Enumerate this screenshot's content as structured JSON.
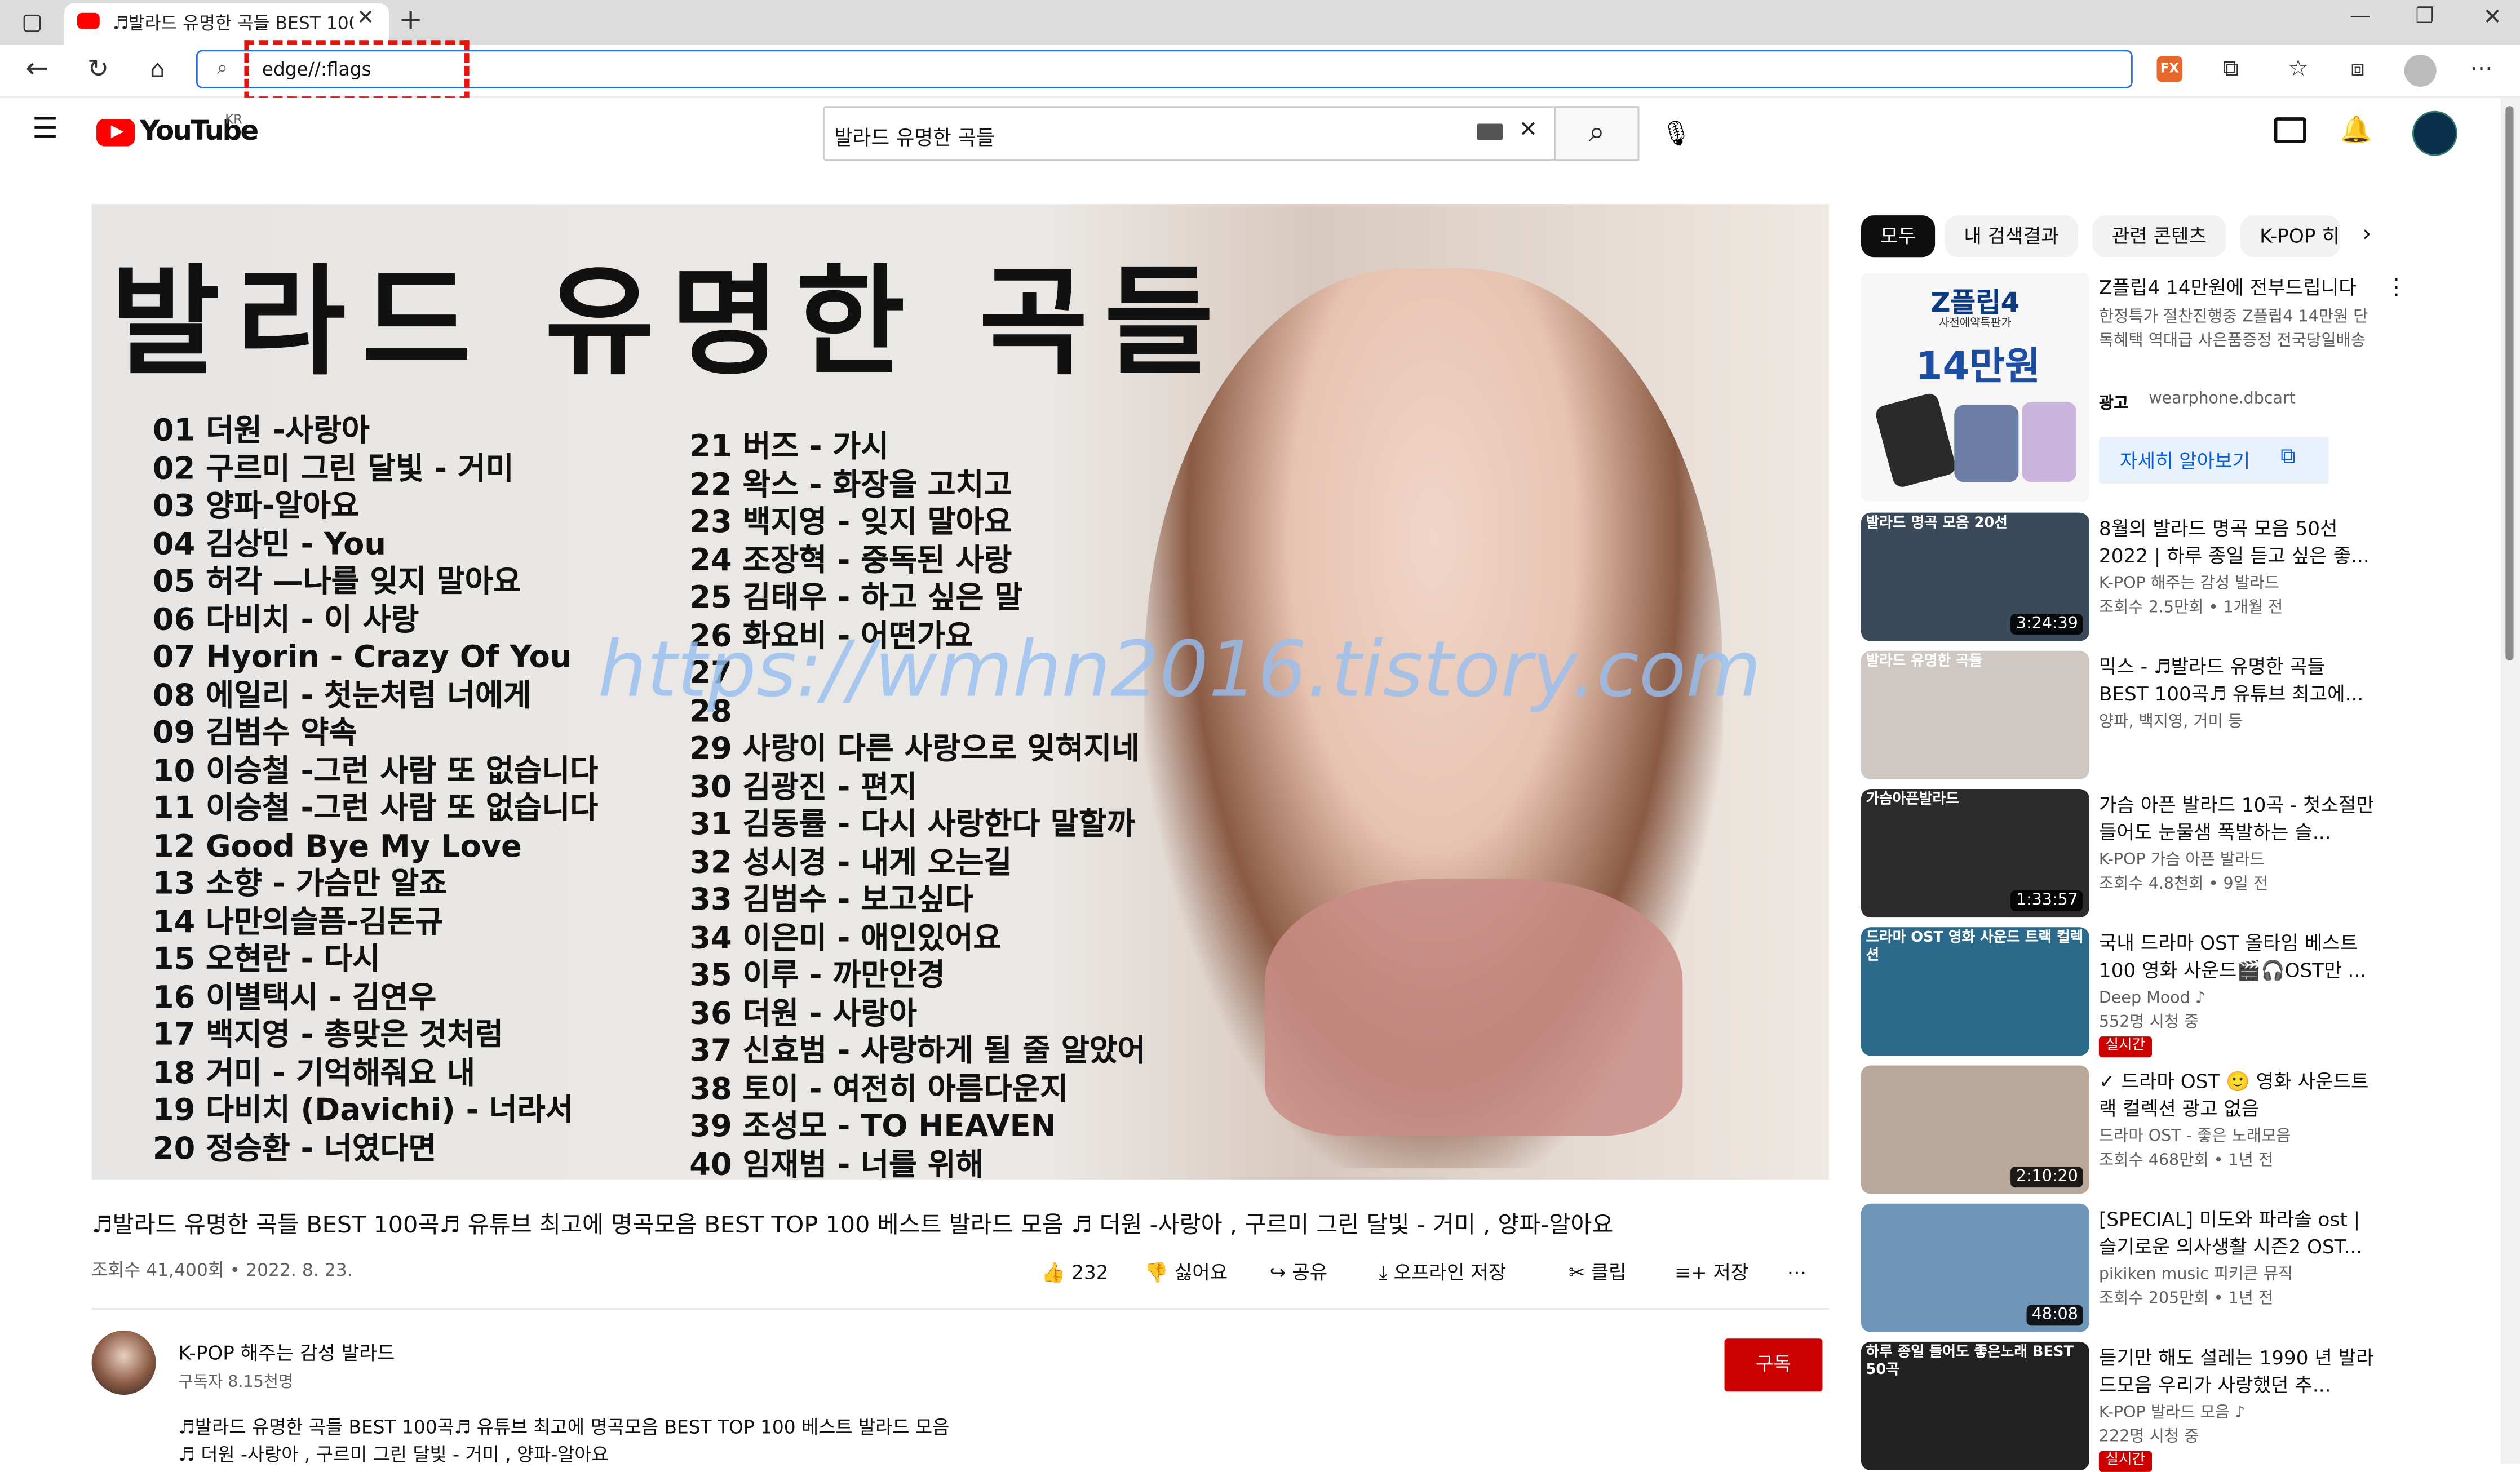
{
  "browser": {
    "tab_title": "♬발라드 유명한 곡들 BEST 100",
    "url": "edge//:flags",
    "ext_badge": "FX"
  },
  "youtube": {
    "logo_text": "YouTube",
    "region": "KR",
    "search_query": "발라드 유명한 곡들"
  },
  "video": {
    "thumb_title": "발라드 유명한 곡들",
    "songs_left": [
      "01 더원 -사랑아",
      "02 구르미 그린 달빛 - 거미",
      "03 양파-알아요",
      "04 김상민 - You",
      "05 허각 —나를 잊지 말아요",
      "06 다비치 - 이 사랑",
      "07 Hyorin - Crazy Of You",
      "08 에일리 - 첫눈처럼 너에게",
      "09 김범수 약속",
      "10 이승철 -그런 사람 또 없습니다",
      "11 이승철 -그런 사람 또 없습니다",
      "12 Good Bye My Love",
      "13 소향 - 가슴만 알죠",
      "14 나만의슬픔-김돈규",
      "15 오현란 - 다시",
      "16 이별택시 - 김연우",
      "17 백지영 - 총맞은 것처럼",
      "18 거미 - 기억해줘요 내",
      "19 다비치 (Davichi) - 너라서",
      "20 정승환 - 너였다면"
    ],
    "songs_right": [
      "21 버즈 - 가시",
      "22 왁스 - 화장을 고치고",
      "23 백지영 - 잊지 말아요",
      "24 조장혁 - 중독된 사랑",
      "25 김태우 - 하고 싶은 말",
      "26 화요비 - 어떤가요",
      "27 ",
      "28 ",
      "29 사랑이 다른 사랑으로 잊혀지네",
      "30 김광진 - 편지",
      "31 김동률 - 다시 사랑한다 말할까",
      "32 성시경 - 내게 오는길",
      "33 김범수 - 보고싶다",
      "34 이은미 - 애인있어요",
      "35 이루 - 까만안경",
      "36 더원 - 사랑아",
      "37 신효범 - 사랑하게 될 줄 알았어",
      "38 토이 - 여전히 아름다운지",
      "39 조성모 - TO HEAVEN",
      "40 임재범 - 너를 위해"
    ],
    "watermark": "https://wmhn2016.tistory.com",
    "title": "♬발라드 유명한 곡들 BEST 100곡♬ 유튜브 최고에 명곡모음 BEST TOP 100 베스트 발라드 모음 ♬ 더원 -사랑아 , 구르미 그린 달빛 - 거미 , 양파-알아요",
    "meta": "조회수 41,400회 • 2022. 8. 23.",
    "likes": "232",
    "dislike": "싫어요",
    "share": "공유",
    "offline": "오프라인 저장",
    "clip": "클립",
    "save": "저장",
    "channel": "K-POP 해주는 감성 발라드",
    "subs": "구독자 8.15천명",
    "subscribe": "구독",
    "desc1": "♬발라드 유명한 곡들 BEST 100곡♬ 유튜브 최고에 명곡모음 BEST TOP 100 베스트 발라드 모음",
    "desc2": "♬ 더원 -사랑아 , 구르미 그린 달빛 - 거미 , 양파-알아요"
  },
  "chips": [
    "모두",
    "내 검색결과",
    "관련 콘텐츠",
    "K-POP 히"
  ],
  "ad": {
    "title": "Z플립4 14만원에 전부드립니다",
    "desc": "한정특가 절찬진행중 Z플립4 14만원 단독혜택 역대급 사은품증정 전국당일배송",
    "label": "광고",
    "domain": "wearphone.dbcart",
    "cta": "자세히 알아보기",
    "thumb_head": "Z플립4",
    "thumb_sub": "사전예약특판가",
    "thumb_price": "14만원"
  },
  "side_items": [
    {
      "title": "8월의 발라드 명곡 모음 50선 2022 | 하루 종일 듣고 싶은 좋...",
      "channel": "K-POP 해주는 감성 발라드",
      "meta": "조회수 2.5만회 • 1개월 전",
      "duration": "3:24:39",
      "thumb_text": "발라드 명곡 모음 20선",
      "color": "#3a4a5a"
    },
    {
      "title": "믹스 - ♬발라드 유명한 곡들 BEST 100곡♬ 유튜브 최고에...",
      "channel": "양파, 백지영, 거미 등",
      "meta": "",
      "duration": "",
      "thumb_text": "발라드 유명한 곡들",
      "color": "#cfc8c2"
    },
    {
      "title": "가슴 아픈 발라드 10곡 - 첫소절만 들어도 눈물샘 폭발하는 슬...",
      "channel": "K-POP 가슴 아픈 발라드",
      "meta": "조회수 4.8천회 • 9일 전",
      "duration": "1:33:57",
      "thumb_text": "가슴아픈발라드",
      "color": "#2c2c2c"
    },
    {
      "title": "국내 드라마 OST 올타임 베스트 100 영화 사운드🎬🎧OST만 ...",
      "channel": "Deep Mood ♪",
      "meta": "552명 시청 중",
      "duration": "",
      "live": "실시간",
      "thumb_text": "드라마 OST 영화 사운드 트랙 컬렉션",
      "color": "#2b6a8a"
    },
    {
      "title": "✓ 드라마 OST 🙂 영화 사운드트랙 컬렉션 광고 없음",
      "channel": "드라마 OST - 좋은 노래모음",
      "meta": "조회수 468만회 • 1년 전",
      "duration": "2:10:20",
      "thumb_text": "",
      "color": "#b9a79a"
    },
    {
      "title": "[SPECIAL] 미도와 파라솔 ost | 슬기로운 의사생활 시즌2 OST...",
      "channel": "pikiken music 피키큰 뮤직",
      "meta": "조회수 205만회 • 1년 전",
      "duration": "48:08",
      "thumb_text": "",
      "color": "#6f96b8"
    },
    {
      "title": "듣기만 해도 설레는 1990 년 발라드모음 우리가 사랑했던 추...",
      "channel": "K-POP 발라드 모음 ♪",
      "meta": "222명 시청 중",
      "duration": "",
      "live": "실시간",
      "thumb_text": "하루 종일 들어도 좋은노래 BEST 50곡",
      "color": "#222"
    }
  ]
}
